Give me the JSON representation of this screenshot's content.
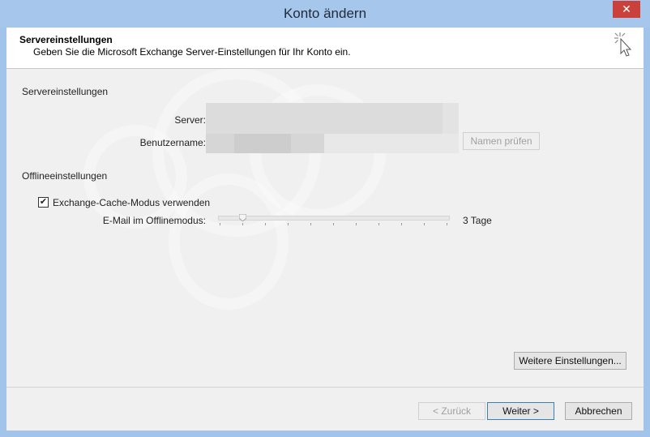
{
  "window": {
    "title": "Konto ändern",
    "close_glyph": "✕"
  },
  "header": {
    "title": "Servereinstellungen",
    "subtitle": "Geben Sie die Microsoft Exchange Server-Einstellungen für Ihr Konto ein.",
    "icon": "wizard-cursor-icon"
  },
  "server_settings": {
    "section_label": "Servereinstellungen",
    "server_label": "Server:",
    "username_label": "Benutzername:",
    "check_names_button": "Namen prüfen"
  },
  "offline_settings": {
    "section_label": "Offlineeinstellungen",
    "cache_mode_label": "Exchange-Cache-Modus verwenden",
    "cache_mode_checked": true,
    "offline_mail_label": "E-Mail im Offlinemodus:",
    "offline_mail_value": "3 Tage",
    "slider_tick_count": 11,
    "slider_position_index": 1
  },
  "buttons": {
    "more_settings": "Weitere Einstellungen...",
    "back": "< Zurück",
    "next": "Weiter >",
    "cancel": "Abbrechen"
  }
}
